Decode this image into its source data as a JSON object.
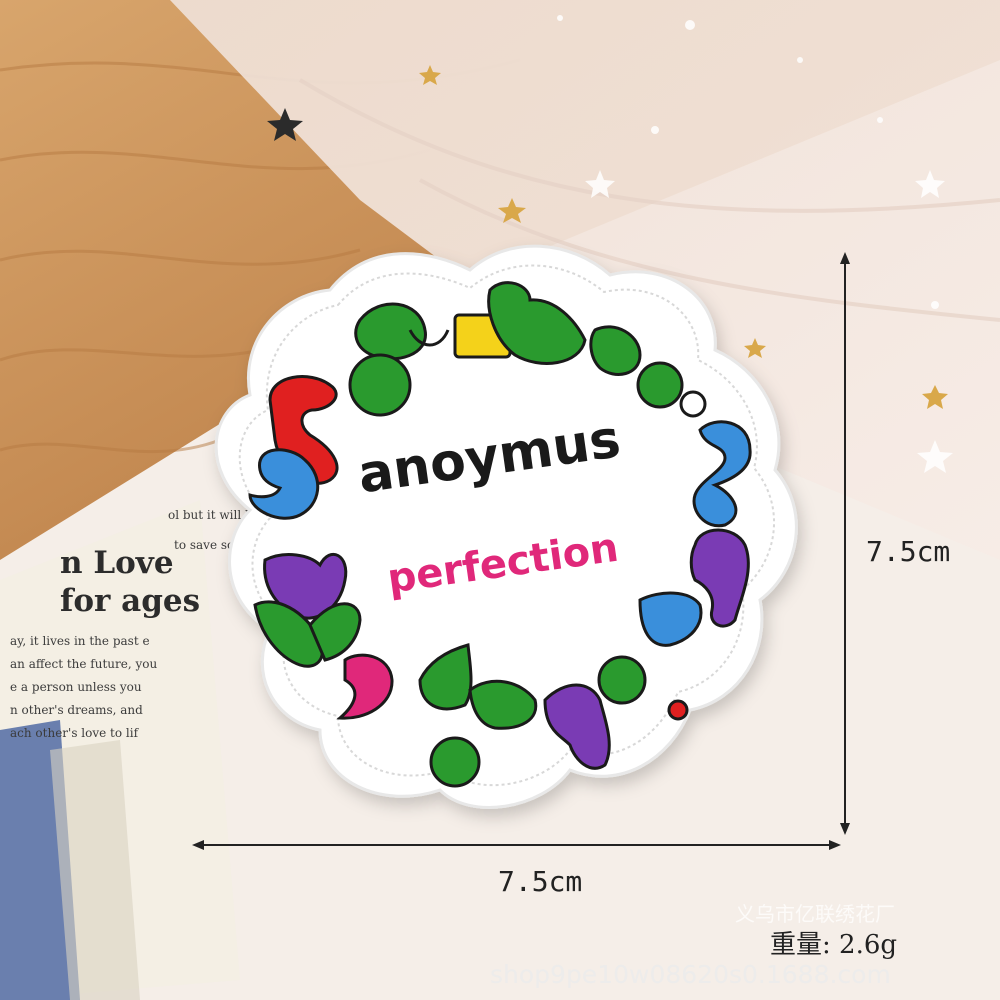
{
  "patch": {
    "word_main": "anoymus",
    "word_sub": "perfection"
  },
  "dimensions": {
    "width_label": "7.5cm",
    "height_label": "7.5cm"
  },
  "book_text": {
    "title_line1": "n Love",
    "title_line2": "for ages",
    "lines": [
      "ol but it will be once",
      "to save someone",
      "ay, it lives in the past e",
      "an affect the future, you",
      "e a person unless you",
      "n other's dreams, and",
      "ach other's love to lif"
    ]
  },
  "watermark": {
    "shop_name": "义乌市亿联绣花厂",
    "url": "shop9pe10w08620s0.1688.com"
  },
  "weight_label": "重量: 2.6g",
  "colors": {
    "wood": "#c9935e",
    "patch_white": "#ffffff",
    "outline": "#1a1a1a",
    "green": "#2a9a2e",
    "yellow": "#f4d21a",
    "red": "#e02020",
    "blue": "#3a8fdb",
    "purple": "#7a3bb4",
    "pink": "#e0287a"
  }
}
